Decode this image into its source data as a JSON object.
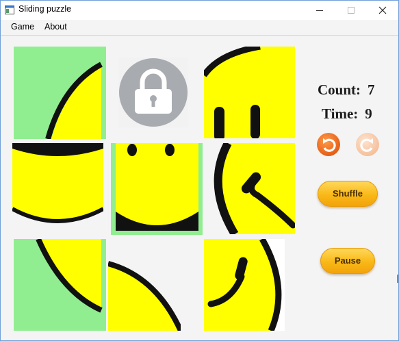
{
  "window": {
    "title": "Sliding puzzle"
  },
  "menu": {
    "items": [
      "Game",
      "About"
    ]
  },
  "stats": {
    "count_label": "Count:",
    "count_value": "7",
    "time_label": "Time:",
    "time_value": "9"
  },
  "buttons": {
    "shuffle": "Shuffle",
    "pause": "Pause"
  },
  "icons": {
    "undo": "undo-icon",
    "redo": "redo-icon",
    "locked_tile": "lock-icon"
  },
  "colors": {
    "smiley_yellow": "#ffff00",
    "correct_tile_background": "#90ee90",
    "accent_orange": "#f9b817",
    "undo_orange": "#e8641a"
  }
}
